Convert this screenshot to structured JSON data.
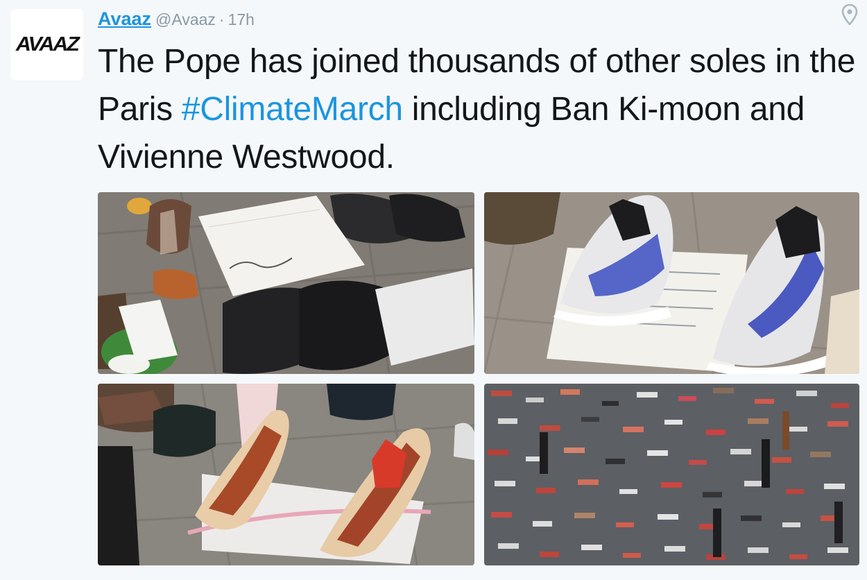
{
  "tweet": {
    "avatar_text": "AVAAZ",
    "display_name": "Avaaz",
    "handle": "@Avaaz",
    "separator": "·",
    "time": "17h",
    "text_before": "The Pope has joined thousands of other soles in the Paris ",
    "hashtag": "#ClimateMarch",
    "text_after": " including Ban Ki-moon and Vivienne Westwood.",
    "location_icon": "map-pin-icon",
    "colors": {
      "link": "#1b95e0",
      "text": "#14171a",
      "muted": "#8899a6",
      "background": "#f5f8fa"
    }
  },
  "photos": [
    {
      "subject": "black dress shoes with handwritten note signed Franciscus"
    },
    {
      "subject": "white and blue running shoes with handwritten letter"
    },
    {
      "subject": "beige heeled shoes with pink ribbon"
    },
    {
      "subject": "square filled with thousands of shoes"
    }
  ]
}
